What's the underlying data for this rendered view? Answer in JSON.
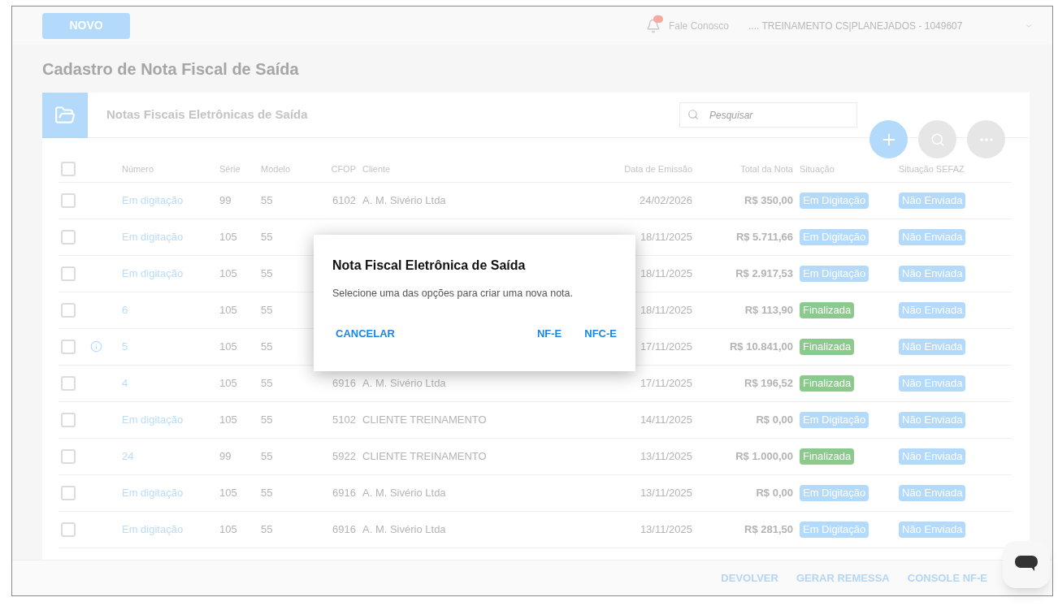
{
  "topbar": {
    "new_button": "NOVO",
    "notification_badge": true,
    "contact": "Fale Conosco",
    "company": ".... TREINAMENTO CS|PLANEJADOS - 1049607"
  },
  "page_title": "Cadastro de Nota Fiscal de Saída",
  "panel": {
    "title": "Notas Fiscais Eletrônicas de Saída",
    "search": {
      "placeholder": "Pesquisar"
    }
  },
  "table": {
    "select_all": {
      "checked": false
    },
    "columns": [
      "Número",
      "Série",
      "Modelo",
      "CFOP",
      "Cliente",
      "Data de Emissão",
      "Total da Nota",
      "Situação",
      "Situação SEFAZ"
    ],
    "rows": [
      {
        "checked": false,
        "info": false,
        "numero": "Em digitação",
        "serie": "99",
        "modelo": "55",
        "cfop": "6102",
        "cliente": "A. M. Sivério Ltda",
        "data": "24/02/2026",
        "total": "R$ 350,00",
        "situacao": {
          "label": "Em Digitação",
          "kind": "draft"
        },
        "sefaz": "Não Enviada"
      },
      {
        "checked": false,
        "info": false,
        "numero": "Em digitação",
        "serie": "105",
        "modelo": "55",
        "data": "18/11/2025",
        "total": "R$ 5.711,66",
        "situacao": {
          "label": "Em Digitação",
          "kind": "draft"
        },
        "sefaz": "Não Enviada"
      },
      {
        "checked": false,
        "info": false,
        "numero": "Em digitação",
        "serie": "105",
        "modelo": "55",
        "data": "18/11/2025",
        "total": "R$ 2.917,53",
        "situacao": {
          "label": "Em Digitação",
          "kind": "draft"
        },
        "sefaz": "Não Enviada"
      },
      {
        "checked": false,
        "info": false,
        "numero": "6",
        "serie": "105",
        "modelo": "55",
        "data": "18/11/2025",
        "total": "R$ 113,90",
        "situacao": {
          "label": "Finalizada",
          "kind": "done"
        },
        "sefaz": "Não Enviada"
      },
      {
        "checked": false,
        "info": true,
        "numero": "5",
        "serie": "105",
        "modelo": "55",
        "data": "17/11/2025",
        "total": "R$ 10.841,00",
        "situacao": {
          "label": "Finalizada",
          "kind": "done"
        },
        "sefaz": "Não Enviada"
      },
      {
        "checked": false,
        "info": false,
        "numero": "4",
        "serie": "105",
        "modelo": "55",
        "cfop": "6916",
        "cliente": "A. M. Sivério Ltda",
        "data": "17/11/2025",
        "total": "R$ 196,52",
        "situacao": {
          "label": "Finalizada",
          "kind": "done"
        },
        "sefaz": "Não Enviada"
      },
      {
        "checked": false,
        "info": false,
        "numero": "Em digitação",
        "serie": "105",
        "modelo": "55",
        "cfop": "5102",
        "cliente": "CLIENTE TREINAMENTO",
        "data": "14/11/2025",
        "total": "R$ 0,00",
        "situacao": {
          "label": "Em Digitação",
          "kind": "draft"
        },
        "sefaz": "Não Enviada"
      },
      {
        "checked": false,
        "info": false,
        "numero": "24",
        "serie": "99",
        "modelo": "55",
        "cfop": "5922",
        "cliente": "CLIENTE TREINAMENTO",
        "data": "13/11/2025",
        "total": "R$ 1.000,00",
        "situacao": {
          "label": "Finalizada",
          "kind": "done"
        },
        "sefaz": "Não Enviada"
      },
      {
        "checked": false,
        "info": false,
        "numero": "Em digitação",
        "serie": "105",
        "modelo": "55",
        "cfop": "6916",
        "cliente": "A. M. Sivério Ltda",
        "data": "13/11/2025",
        "total": "R$ 0,00",
        "situacao": {
          "label": "Em Digitação",
          "kind": "draft"
        },
        "sefaz": "Não Enviada"
      },
      {
        "checked": false,
        "info": false,
        "numero": "Em digitação",
        "serie": "105",
        "modelo": "55",
        "cfop": "6916",
        "cliente": "A. M. Sivério Ltda",
        "data": "13/11/2025",
        "total": "R$ 281,50",
        "situacao": {
          "label": "Em Digitação",
          "kind": "draft"
        },
        "sefaz": "Não Enviada"
      }
    ]
  },
  "footer_actions": [
    "DEVOLVER",
    "GERAR REMESSA",
    "CONSOLE NF-E"
  ],
  "dialog": {
    "title": "Nota Fiscal Eletrônica de Saída",
    "message": "Selecione uma das opções para criar uma nova nota.",
    "cancel": "CANCELAR",
    "options": [
      "NF-E",
      "NFC-E"
    ]
  }
}
